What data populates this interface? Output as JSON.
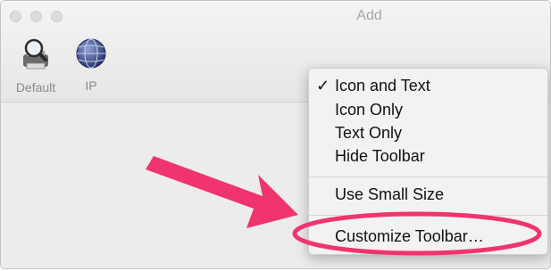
{
  "window": {
    "title": "Add"
  },
  "toolbar": {
    "items": [
      {
        "label": "Default",
        "icon": "printer-magnifier-icon"
      },
      {
        "label": "IP",
        "icon": "globe-icon"
      }
    ]
  },
  "context_menu": {
    "items": [
      {
        "label": "Icon and Text",
        "checked": true,
        "check_glyph": "✓"
      },
      {
        "label": "Icon Only",
        "checked": false
      },
      {
        "label": "Text Only",
        "checked": false
      },
      {
        "label": "Hide Toolbar",
        "checked": false
      },
      {
        "label": "Use Small Size",
        "checked": false
      },
      {
        "label": "Customize Toolbar…",
        "checked": false,
        "highlighted": true
      }
    ]
  },
  "annotation": {
    "color": "#f0346e",
    "icon": "arrow-annotation"
  }
}
